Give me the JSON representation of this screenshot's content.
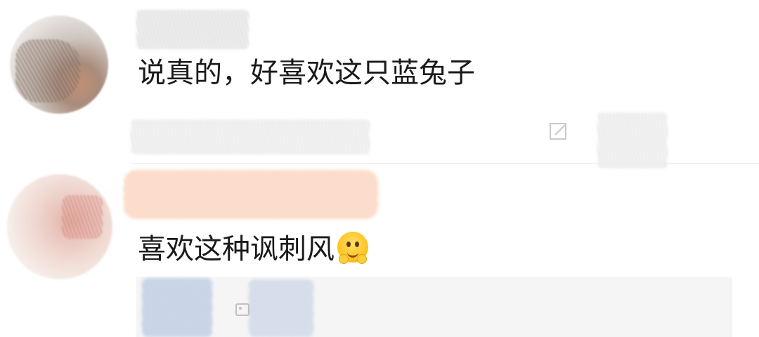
{
  "comments": [
    {
      "text": "说真的，好喜欢这只蓝兔子",
      "avatar_icon": "blurred-user-avatar",
      "action_icon": "edit-icon"
    },
    {
      "text": "喜欢这种讽刺风",
      "emoji": "🥹",
      "emoji_icon": "holding-back-tears-emoji",
      "avatar_icon": "blurred-user-avatar"
    }
  ]
}
